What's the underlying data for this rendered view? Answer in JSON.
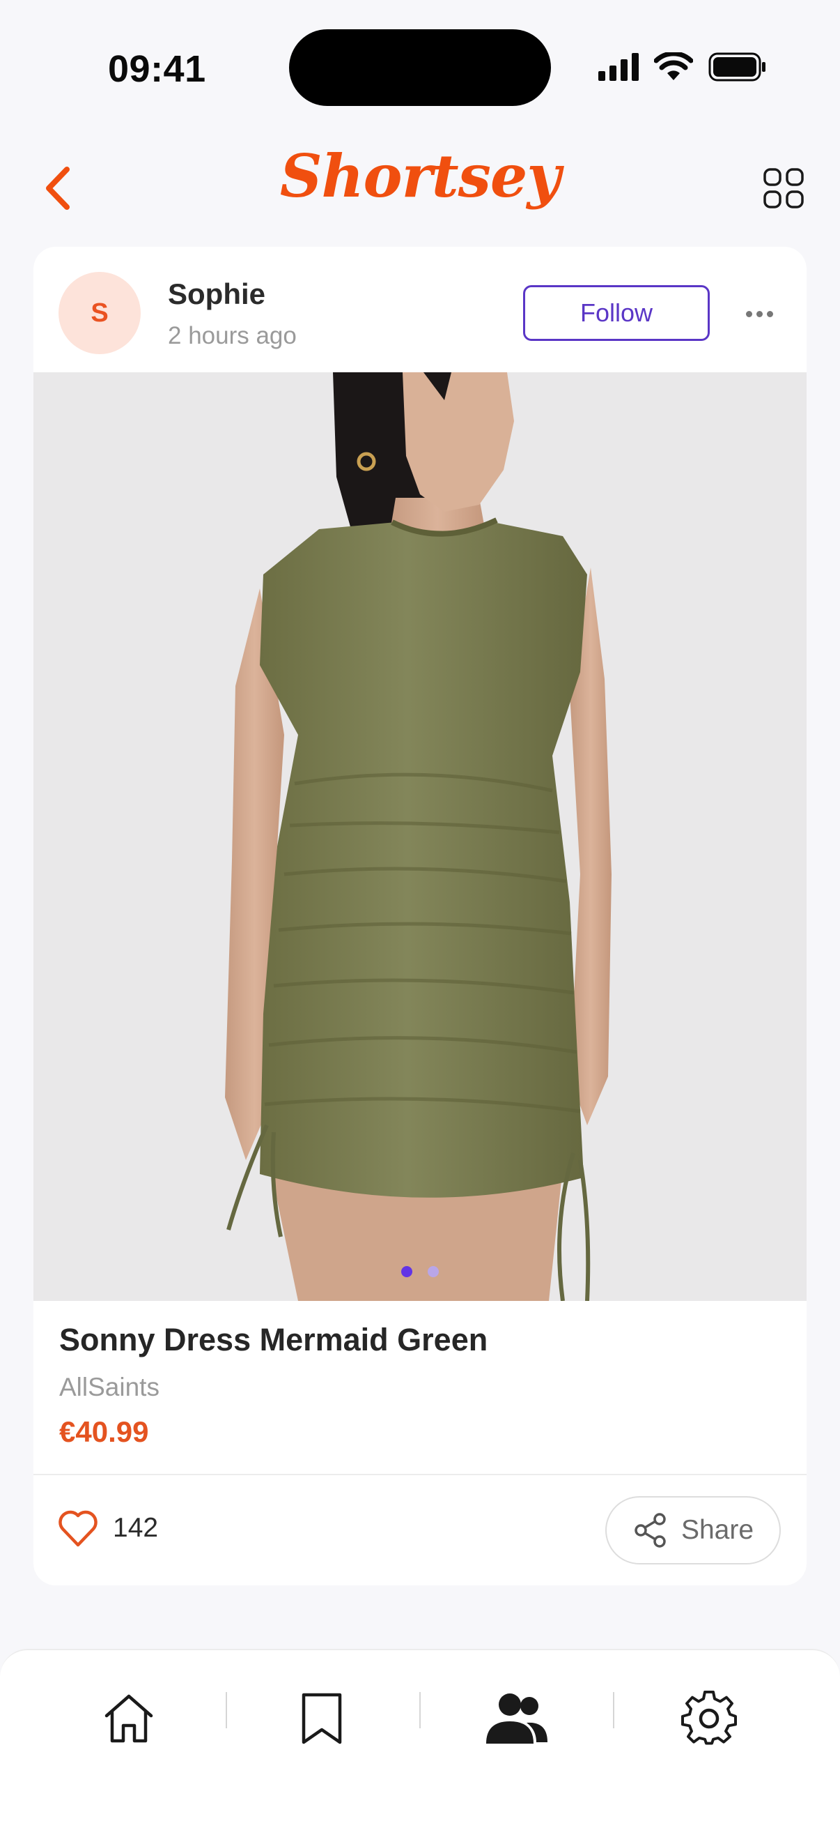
{
  "status_bar": {
    "time": "09:41"
  },
  "header": {
    "logo_text": "Shortsey"
  },
  "post": {
    "avatar_initial": "S",
    "user_name": "Sophie",
    "time_ago": "2 hours ago",
    "follow_label": "Follow",
    "image_count": 2,
    "active_image": 1
  },
  "product": {
    "name": "Sonny Dress Mermaid Green",
    "brand": "AllSaints",
    "price": "€40.99"
  },
  "actions": {
    "like_count": "142",
    "share_label": "Share"
  },
  "tab_bar": {
    "items": [
      {
        "icon": "home-icon",
        "active": false
      },
      {
        "icon": "bookmark-icon",
        "active": false
      },
      {
        "icon": "people-icon",
        "active": true
      },
      {
        "icon": "settings-icon",
        "active": false
      }
    ]
  },
  "colors": {
    "brand": "#f04f0f",
    "follow": "#5a36c6",
    "price": "#e45320",
    "dress": "#7d7f51"
  }
}
